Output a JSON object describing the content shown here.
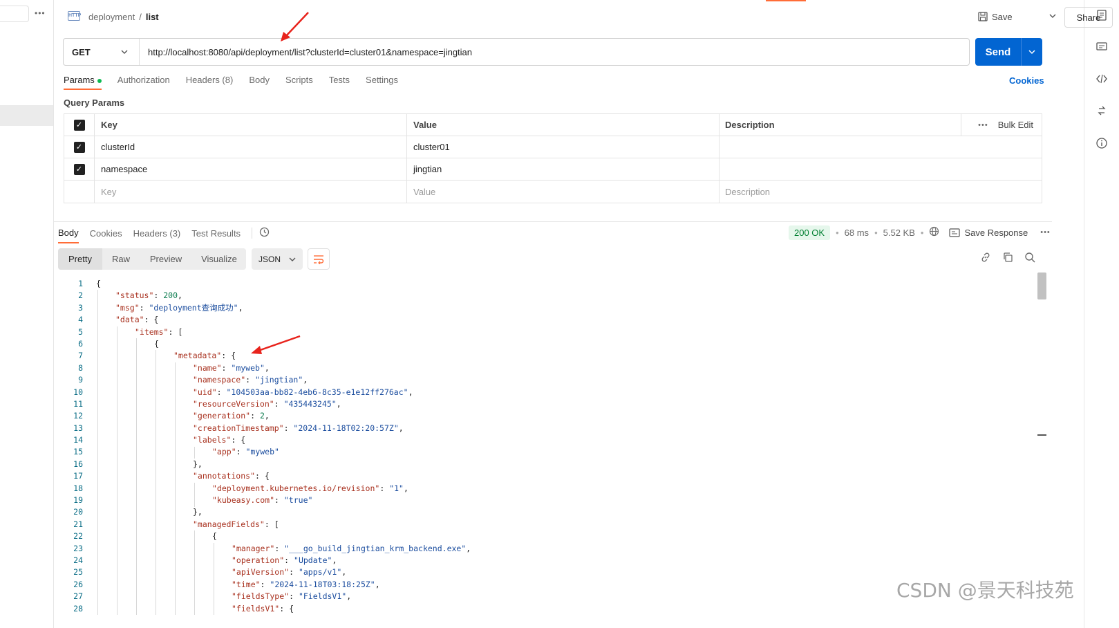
{
  "header": {
    "breadcrumb_parent": "deployment",
    "breadcrumb_sep": "/",
    "breadcrumb_current": "list",
    "save_label": "Save",
    "share_label": "Share"
  },
  "request": {
    "method": "GET",
    "url": "http://localhost:8080/api/deployment/list?clusterId=cluster01&namespace=jingtian",
    "send_label": "Send"
  },
  "tabs": {
    "items": [
      "Params",
      "Authorization",
      "Headers (8)",
      "Body",
      "Scripts",
      "Tests",
      "Settings"
    ],
    "cookies_label": "Cookies"
  },
  "params": {
    "title": "Query Params",
    "headers": {
      "key": "Key",
      "value": "Value",
      "description": "Description",
      "bulk_edit": "Bulk Edit"
    },
    "rows": [
      {
        "key": "clusterId",
        "value": "cluster01",
        "checked": true
      },
      {
        "key": "namespace",
        "value": "jingtian",
        "checked": true
      }
    ],
    "placeholders": {
      "key": "Key",
      "value": "Value",
      "description": "Description"
    }
  },
  "response": {
    "tabs": [
      "Body",
      "Cookies",
      "Headers (3)",
      "Test Results"
    ],
    "status": "200 OK",
    "time": "68 ms",
    "size": "5.52 KB",
    "save_response": "Save Response",
    "formats": [
      "Pretty",
      "Raw",
      "Preview",
      "Visualize"
    ],
    "language": "JSON"
  },
  "code_lines": [
    {
      "n": "1",
      "indent": 0,
      "parts": [
        [
          "p",
          "{"
        ]
      ]
    },
    {
      "n": "2",
      "indent": 1,
      "parts": [
        [
          "k",
          "\"status\""
        ],
        [
          "p",
          ": "
        ],
        [
          "n",
          "200"
        ],
        [
          "p",
          ","
        ]
      ]
    },
    {
      "n": "3",
      "indent": 1,
      "parts": [
        [
          "k",
          "\"msg\""
        ],
        [
          "p",
          ": "
        ],
        [
          "s",
          "\"deployment查询成功\""
        ],
        [
          "p",
          ","
        ]
      ]
    },
    {
      "n": "4",
      "indent": 1,
      "parts": [
        [
          "k",
          "\"data\""
        ],
        [
          "p",
          ": {"
        ]
      ]
    },
    {
      "n": "5",
      "indent": 2,
      "parts": [
        [
          "k",
          "\"items\""
        ],
        [
          "p",
          ": ["
        ]
      ]
    },
    {
      "n": "6",
      "indent": 3,
      "parts": [
        [
          "p",
          "{"
        ]
      ]
    },
    {
      "n": "7",
      "indent": 4,
      "parts": [
        [
          "k",
          "\"metadata\""
        ],
        [
          "p",
          ": {"
        ]
      ]
    },
    {
      "n": "8",
      "indent": 5,
      "parts": [
        [
          "k",
          "\"name\""
        ],
        [
          "p",
          ": "
        ],
        [
          "s",
          "\"myweb\""
        ],
        [
          "p",
          ","
        ]
      ]
    },
    {
      "n": "9",
      "indent": 5,
      "parts": [
        [
          "k",
          "\"namespace\""
        ],
        [
          "p",
          ": "
        ],
        [
          "s",
          "\"jingtian\""
        ],
        [
          "p",
          ","
        ]
      ]
    },
    {
      "n": "10",
      "indent": 5,
      "parts": [
        [
          "k",
          "\"uid\""
        ],
        [
          "p",
          ": "
        ],
        [
          "s",
          "\"104503aa-bb82-4eb6-8c35-e1e12ff276ac\""
        ],
        [
          "p",
          ","
        ]
      ]
    },
    {
      "n": "11",
      "indent": 5,
      "parts": [
        [
          "k",
          "\"resourceVersion\""
        ],
        [
          "p",
          ": "
        ],
        [
          "s",
          "\"435443245\""
        ],
        [
          "p",
          ","
        ]
      ]
    },
    {
      "n": "12",
      "indent": 5,
      "parts": [
        [
          "k",
          "\"generation\""
        ],
        [
          "p",
          ": "
        ],
        [
          "n",
          "2"
        ],
        [
          "p",
          ","
        ]
      ]
    },
    {
      "n": "13",
      "indent": 5,
      "parts": [
        [
          "k",
          "\"creationTimestamp\""
        ],
        [
          "p",
          ": "
        ],
        [
          "s",
          "\"2024-11-18T02:20:57Z\""
        ],
        [
          "p",
          ","
        ]
      ]
    },
    {
      "n": "14",
      "indent": 5,
      "parts": [
        [
          "k",
          "\"labels\""
        ],
        [
          "p",
          ": {"
        ]
      ]
    },
    {
      "n": "15",
      "indent": 6,
      "parts": [
        [
          "k",
          "\"app\""
        ],
        [
          "p",
          ": "
        ],
        [
          "s",
          "\"myweb\""
        ]
      ]
    },
    {
      "n": "16",
      "indent": 5,
      "parts": [
        [
          "p",
          "},"
        ]
      ]
    },
    {
      "n": "17",
      "indent": 5,
      "parts": [
        [
          "k",
          "\"annotations\""
        ],
        [
          "p",
          ": {"
        ]
      ]
    },
    {
      "n": "18",
      "indent": 6,
      "parts": [
        [
          "k",
          "\"deployment.kubernetes.io/revision\""
        ],
        [
          "p",
          ": "
        ],
        [
          "s",
          "\"1\""
        ],
        [
          "p",
          ","
        ]
      ]
    },
    {
      "n": "19",
      "indent": 6,
      "parts": [
        [
          "k",
          "\"kubeasy.com\""
        ],
        [
          "p",
          ": "
        ],
        [
          "s",
          "\"true\""
        ]
      ]
    },
    {
      "n": "20",
      "indent": 5,
      "parts": [
        [
          "p",
          "},"
        ]
      ]
    },
    {
      "n": "21",
      "indent": 5,
      "parts": [
        [
          "k",
          "\"managedFields\""
        ],
        [
          "p",
          ": ["
        ]
      ]
    },
    {
      "n": "22",
      "indent": 6,
      "parts": [
        [
          "p",
          "{"
        ]
      ]
    },
    {
      "n": "23",
      "indent": 7,
      "parts": [
        [
          "k",
          "\"manager\""
        ],
        [
          "p",
          ": "
        ],
        [
          "s",
          "\"___go_build_jingtian_krm_backend.exe\""
        ],
        [
          "p",
          ","
        ]
      ]
    },
    {
      "n": "24",
      "indent": 7,
      "parts": [
        [
          "k",
          "\"operation\""
        ],
        [
          "p",
          ": "
        ],
        [
          "s",
          "\"Update\""
        ],
        [
          "p",
          ","
        ]
      ]
    },
    {
      "n": "25",
      "indent": 7,
      "parts": [
        [
          "k",
          "\"apiVersion\""
        ],
        [
          "p",
          ": "
        ],
        [
          "s",
          "\"apps/v1\""
        ],
        [
          "p",
          ","
        ]
      ]
    },
    {
      "n": "26",
      "indent": 7,
      "parts": [
        [
          "k",
          "\"time\""
        ],
        [
          "p",
          ": "
        ],
        [
          "s",
          "\"2024-11-18T03:18:25Z\""
        ],
        [
          "p",
          ","
        ]
      ]
    },
    {
      "n": "27",
      "indent": 7,
      "parts": [
        [
          "k",
          "\"fieldsType\""
        ],
        [
          "p",
          ": "
        ],
        [
          "s",
          "\"FieldsV1\""
        ],
        [
          "p",
          ","
        ]
      ]
    },
    {
      "n": "28",
      "indent": 7,
      "parts": [
        [
          "k",
          "\"fieldsV1\""
        ],
        [
          "p",
          ": {"
        ]
      ]
    }
  ],
  "watermark": "CSDN @景天科技苑",
  "colors": {
    "accent": "#ff6c37",
    "send": "#0265d2",
    "status_ok": "#007f31"
  }
}
